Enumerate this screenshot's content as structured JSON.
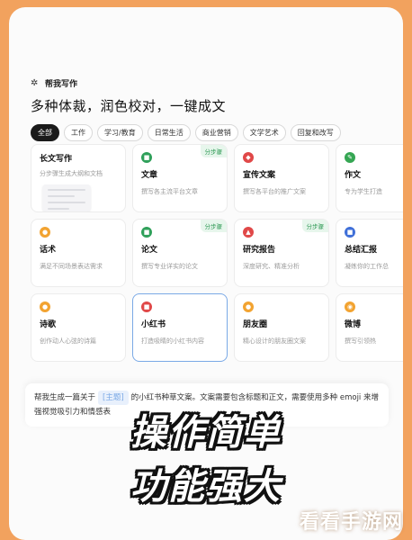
{
  "app": {
    "name": "帮我写作",
    "headline": "多种体裁，润色校对，一键成文"
  },
  "tabs": [
    {
      "label": "全部",
      "active": true
    },
    {
      "label": "工作"
    },
    {
      "label": "学习/教育"
    },
    {
      "label": "日常生活"
    },
    {
      "label": "商业营销"
    },
    {
      "label": "文学艺术"
    },
    {
      "label": "回复和改写"
    }
  ],
  "badge_label": "分步骤",
  "cards": [
    {
      "title": "长文写作",
      "desc": "分步骤生成大纲和文档",
      "long": true
    },
    {
      "title": "文章",
      "desc": "撰写各主流平台文章",
      "icon_color": "#2fa05a",
      "icon": "document-icon",
      "badge": true
    },
    {
      "title": "宣传文案",
      "desc": "撰写各平台的推广文案",
      "icon_color": "#e04848",
      "icon": "megaphone-icon"
    },
    {
      "title": "作文",
      "desc": "专为学生打造",
      "icon_color": "#35a653",
      "icon": "pen-icon"
    },
    {
      "title": "话术",
      "desc": "满足不同场景表达需求",
      "icon_color": "#f2a331",
      "icon": "chat-icon"
    },
    {
      "title": "论文",
      "desc": "撰写专业详实的论文",
      "icon_color": "#2fa05a",
      "icon": "paper-icon",
      "badge": true
    },
    {
      "title": "研究报告",
      "desc": "深度研究、精准分析",
      "icon_color": "#e04848",
      "icon": "report-icon",
      "badge": true
    },
    {
      "title": "总结汇报",
      "desc": "凝练你的工作总",
      "icon_color": "#3f6fd8",
      "icon": "summary-icon"
    },
    {
      "title": "诗歌",
      "desc": "创作动人心弦的诗篇",
      "icon_color": "#f2a331",
      "icon": "poem-icon"
    },
    {
      "title": "小红书",
      "desc": "打造吸睛的小红书内容",
      "icon_color": "#e04848",
      "icon": "book-icon",
      "selected": true
    },
    {
      "title": "朋友圈",
      "desc": "精心设计的朋友圈文案",
      "icon_color": "#f2a331",
      "icon": "moments-icon"
    },
    {
      "title": "微博",
      "desc": "撰写引领热",
      "icon_color": "#f2a331",
      "icon": "weibo-icon"
    }
  ],
  "input": {
    "prefix": "帮我生成一篇关于",
    "topic_chip": "[主题]",
    "suffix": "的小红书种草文案。文案需要包含标题和正文，需要使用多种 emoji 来增强视觉吸引力和情感表"
  },
  "overlay": {
    "line1": "操作简单",
    "line2": "功能强大"
  },
  "watermark": "看看手游网",
  "colors": {
    "background": "#f2a25e",
    "selected_border": "#7aa9e6",
    "badge": "#2f9a55"
  }
}
